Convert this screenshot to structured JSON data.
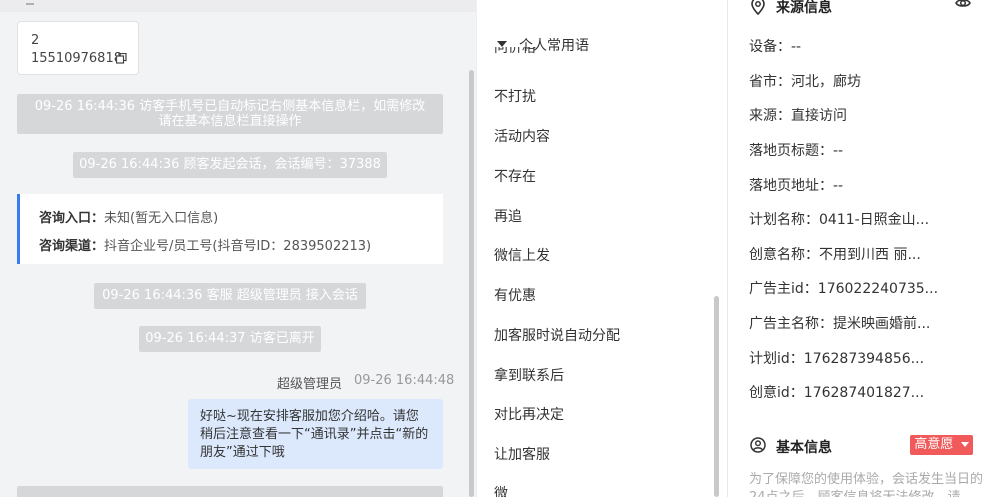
{
  "chat": {
    "phone_card": {
      "line1": "2",
      "line2": "15510976818"
    },
    "system_msgs": [
      "09-26 16:44:36 访客手机号已自动标记右侧基本信息栏，如需修改\n请在基本信息栏直接操作",
      "09-26 16:44:36 顾客发起会话，会话编号：37388",
      "09-26 16:44:36 客服 超级管理员 接入会话",
      "09-26 16:44:37 访客已离开"
    ],
    "info_card": {
      "entry_label": "咨询入口：",
      "entry_value": "未知(暂无入口信息)",
      "channel_label": "咨询渠道：",
      "channel_value": "抖音企业号/员工号(抖音号ID：2839502213)"
    },
    "agent_name": "超级管理员",
    "agent_time": "09-26 16:44:48",
    "message": "好哒~现在安排客服加您介绍哈。请您稍后注意查看一下“通讯录”并点击“新的朋友”通过下哦"
  },
  "phrases": {
    "header": "个人常用语",
    "partial_item": "问价格",
    "items": [
      "不打扰",
      "活动内容",
      "不存在",
      "再追",
      "微信上发",
      "有优惠",
      "加客服时说自动分配",
      "拿到联系后",
      "对比再决定",
      "让加客服",
      "微"
    ]
  },
  "right": {
    "source_title": "来源信息",
    "fields": [
      {
        "label": "设备：",
        "value": "--"
      },
      {
        "label": "省市：",
        "value": "河北，廊坊"
      },
      {
        "label": "来源：",
        "value": "直接访问"
      },
      {
        "label": "落地页标题：",
        "value": "--"
      },
      {
        "label": "落地页地址：",
        "value": "--"
      },
      {
        "label": "计划名称：",
        "value": "0411-日照金山..."
      },
      {
        "label": "创意名称：",
        "value": "不用到川西 丽..."
      },
      {
        "label": "广告主id：",
        "value": "176022240735..."
      },
      {
        "label": "广告主名称：",
        "value": "提米映画婚前..."
      },
      {
        "label": "计划id：",
        "value": "176287394856..."
      },
      {
        "label": "创意id：",
        "value": "176287401827..."
      }
    ],
    "basic_title": "基本信息",
    "intent_badge": "高意愿",
    "notice": "为了保障您的使用体验，会话发生当日的24点之后，顾客信息将无法修改，请"
  },
  "colors": {
    "accent_blue": "#3a7bf0",
    "badge_red": "#f05a5a",
    "bubble_bg": "#dce9fd",
    "system_bg": "#d6d7d9"
  }
}
